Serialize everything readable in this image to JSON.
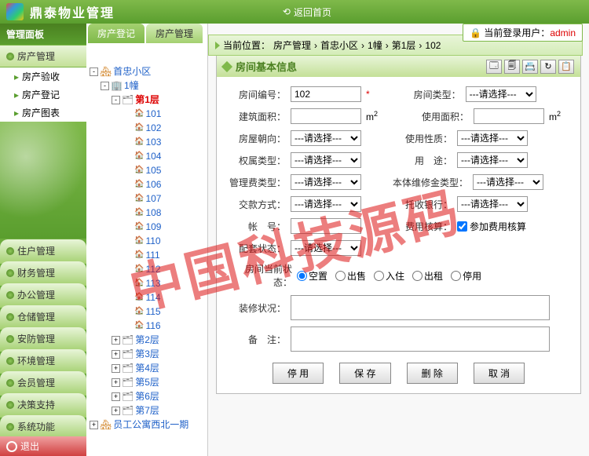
{
  "app": {
    "title": "鼎泰物业管理",
    "home": "返回首页",
    "user_label": "当前登录用户：",
    "user": "admin",
    "exit": "退出"
  },
  "breadcrumb": {
    "label": "当前位置：",
    "p0": "房产管理",
    "p1": "首忠小区",
    "p2": "1幢",
    "p3": "第1层",
    "p4": "102"
  },
  "sidebar": {
    "header": "管理面板",
    "main": "房产管理",
    "subs": [
      "房产验收",
      "房产登记",
      "房产图表"
    ],
    "bottom": [
      "住户管理",
      "财务管理",
      "办公管理",
      "仓储管理",
      "安防管理",
      "环境管理",
      "会员管理",
      "决策支持",
      "系统功能"
    ]
  },
  "tabs": {
    "t1": "房产登记",
    "t2": "房产管理"
  },
  "tree": {
    "root": "首忠小区",
    "building": "1幢",
    "floor1": "第1层",
    "rooms": [
      "101",
      "102",
      "103",
      "104",
      "105",
      "106",
      "107",
      "108",
      "109",
      "110",
      "111",
      "112",
      "113",
      "114",
      "115",
      "116"
    ],
    "floors_rest": [
      "第2层",
      "第3层",
      "第4层",
      "第5层",
      "第6层",
      "第7层"
    ],
    "community2": "员工公寓西北一期"
  },
  "form": {
    "title": "房间基本信息",
    "room_no_label": "房间编号：",
    "room_no": "102",
    "room_type_label": "房间类型：",
    "build_area_label": "建筑面积：",
    "unit_m2": "㎡",
    "use_area_label": "使用面积：",
    "direction_label": "房屋朝向：",
    "use_type_label": "使用性质：",
    "ownership_label": "权属类型：",
    "usage_label": "用　途：",
    "fee_type_label": "管理费类型：",
    "maint_type_label": "本体维修金类型：",
    "pay_method_label": "交款方式：",
    "bank_label": "托收银行：",
    "account_label": "帐　号：",
    "fee_check_label": "费用核算：",
    "join_check": "参加费用核算",
    "equip_status_label": "配套状态：",
    "current_status_label": "房间当前状态：",
    "radios": [
      "空置",
      "出售",
      "入住",
      "出租",
      "停用"
    ],
    "decor_label": "装修状况：",
    "remark_label": "备　注：",
    "select_default": "---请选择---",
    "btns": {
      "disable": "停 用",
      "save": "保 存",
      "delete": "删 除",
      "cancel": "取 消"
    }
  },
  "watermark": "中国科技源码"
}
